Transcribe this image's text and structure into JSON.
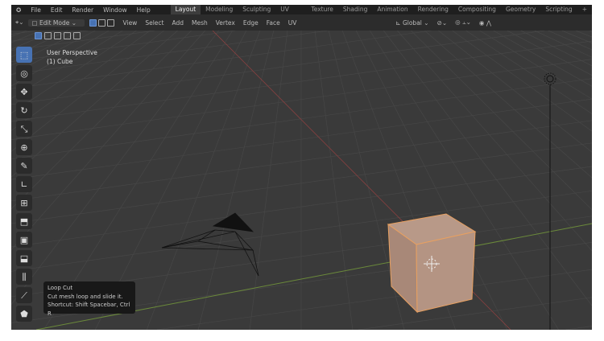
{
  "menu": [
    "File",
    "Edit",
    "Render",
    "Window",
    "Help"
  ],
  "workspaces": [
    "Layout",
    "Modeling",
    "Sculpting",
    "UV Editing",
    "Texture Paint",
    "Shading",
    "Animation",
    "Rendering",
    "Compositing",
    "Geometry Nodes",
    "Scripting",
    "+"
  ],
  "active_workspace": "Layout",
  "header": {
    "mode": "Edit Mode",
    "menus": [
      "View",
      "Select",
      "Add",
      "Mesh",
      "Vertex",
      "Edge",
      "Face",
      "UV"
    ],
    "orientation": "Global"
  },
  "viewport": {
    "view_name": "User Perspective",
    "object": "(1) Cube"
  },
  "tools": [
    "select-box",
    "cursor",
    "move",
    "rotate",
    "scale",
    "transform",
    "annotate",
    "measure",
    "add-cube",
    "extrude",
    "inset",
    "bevel",
    "loop-cut",
    "knife",
    "poly-build"
  ],
  "tooltip": {
    "title": "Loop Cut",
    "description": "Cut mesh loop and slide it.",
    "shortcut": "Shortcut: Shift Spacebar, Ctrl R"
  },
  "colors": {
    "accent": "#4772b3",
    "selection": "#e8a060",
    "background": "#3a3a3a"
  }
}
